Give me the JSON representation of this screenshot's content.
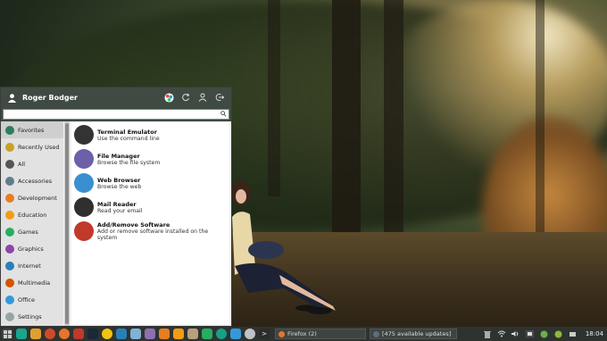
{
  "menu": {
    "user_name": "Roger Bodger",
    "search": {
      "value": "",
      "placeholder": ""
    },
    "categories": [
      {
        "label": "Favorites",
        "icon": "bookmark-icon",
        "color": "#2e7d5b"
      },
      {
        "label": "Recently Used",
        "icon": "clock-icon",
        "color": "#c9a227"
      },
      {
        "label": "All",
        "icon": "grid-icon",
        "color": "#555555"
      },
      {
        "label": "Accessories",
        "icon": "accessories-icon",
        "color": "#607d8b"
      },
      {
        "label": "Development",
        "icon": "wrench-icon",
        "color": "#e67e22"
      },
      {
        "label": "Education",
        "icon": "education-icon",
        "color": "#f39c12"
      },
      {
        "label": "Games",
        "icon": "gamepad-icon",
        "color": "#27ae60"
      },
      {
        "label": "Graphics",
        "icon": "graphics-icon",
        "color": "#8e44ad"
      },
      {
        "label": "Internet",
        "icon": "globe-icon",
        "color": "#2980b9"
      },
      {
        "label": "Multimedia",
        "icon": "multimedia-icon",
        "color": "#d35400"
      },
      {
        "label": "Office",
        "icon": "office-icon",
        "color": "#3498db"
      },
      {
        "label": "Settings",
        "icon": "settings-icon",
        "color": "#95a5a6"
      }
    ],
    "apps": [
      {
        "name": "Terminal Emulator",
        "desc": "Use the command line",
        "icon": "terminal-icon",
        "color": "#333333"
      },
      {
        "name": "File Manager",
        "desc": "Browse the file system",
        "icon": "folder-icon",
        "color": "#6d5fa8"
      },
      {
        "name": "Web Browser",
        "desc": "Browse the web",
        "icon": "browser-icon",
        "color": "#3a8fd1"
      },
      {
        "name": "Mail Reader",
        "desc": "Read your email",
        "icon": "mail-icon",
        "color": "#2f2f2f"
      },
      {
        "name": "Add/Remove Software",
        "desc": "Add or remove software installed on the system",
        "icon": "software-icon",
        "color": "#c0392b"
      }
    ]
  },
  "taskbar": {
    "tasks": [
      {
        "label": "Firefox (2)"
      },
      {
        "label": "[475 available updates]"
      }
    ],
    "clock": "18:04"
  }
}
